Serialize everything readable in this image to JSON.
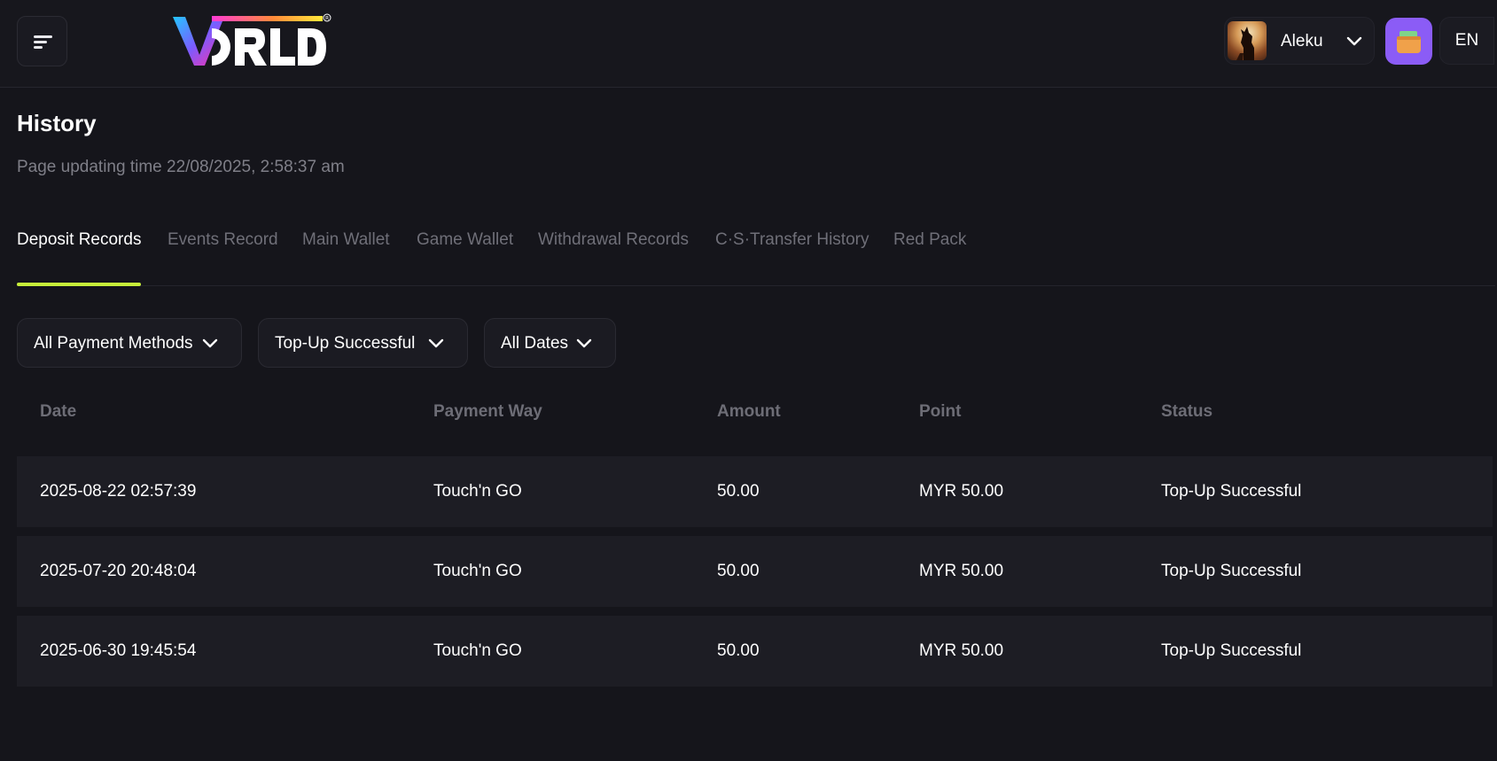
{
  "header": {
    "menu_icon": "hamburger-menu-icon",
    "logo_text": "VORLD",
    "username": "Aleku",
    "wallet_icon": "wallet-icon",
    "language": "EN",
    "colors": {
      "wallet_bg": "#8b5cf6",
      "tab_underline": "#c7ef3a"
    }
  },
  "page": {
    "title": "History",
    "update_label": "Page updating time 22/08/2025, 2:58:37 am"
  },
  "tabs": [
    {
      "label": "Deposit Records",
      "active": true
    },
    {
      "label": "Events Record",
      "active": false
    },
    {
      "label": "Main Wallet",
      "active": false
    },
    {
      "label": "Game Wallet",
      "active": false
    },
    {
      "label": "Withdrawal Records",
      "active": false
    },
    {
      "label": "C·S·Transfer History",
      "active": false
    },
    {
      "label": "Red Pack",
      "active": false
    }
  ],
  "filters": {
    "payment_method": "All Payment Methods",
    "status": "Top-Up Successful",
    "date": "All Dates"
  },
  "table": {
    "columns": [
      "Date",
      "Payment Way",
      "Amount",
      "Point",
      "Status"
    ],
    "rows": [
      {
        "date": "2025-08-22 02:57:39",
        "payment": "Touch'n GO",
        "amount": "50.00",
        "point": "MYR 50.00",
        "status": "Top-Up Successful"
      },
      {
        "date": "2025-07-20 20:48:04",
        "payment": "Touch'n GO",
        "amount": "50.00",
        "point": "MYR 50.00",
        "status": "Top-Up Successful"
      },
      {
        "date": "2025-06-30 19:45:54",
        "payment": "Touch'n GO",
        "amount": "50.00",
        "point": "MYR 50.00",
        "status": "Top-Up Successful"
      }
    ]
  }
}
